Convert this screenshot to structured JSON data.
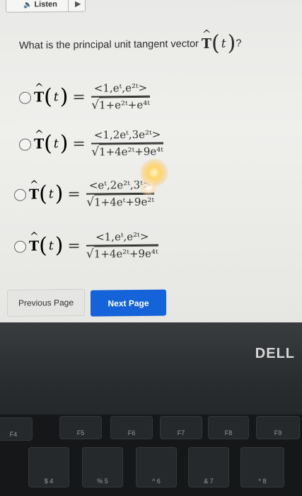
{
  "toolbar": {
    "listen_label": "Listen"
  },
  "question": {
    "text": "What is the principal unit tangent vector",
    "symbol": "T",
    "arg": "t",
    "end": "?"
  },
  "options": [
    {
      "numerator": "<1,eᵗ,e²ᵗ>",
      "radicand": "1+e²ᵗ+e⁴ᵗ"
    },
    {
      "numerator": "<1,2eᵗ,3e²ᵗ>",
      "radicand": "1+4e²ᵗ+9e⁴ᵗ"
    },
    {
      "numerator": "<eᵗ,2e²ᵗ,3ᵗ>",
      "radicand": "1+4eᵗ+9e²ᵗ"
    },
    {
      "numerator": "<1,eᵗ,e²ᵗ>",
      "radicand": "1+4e²ᵗ+9e⁴ᵗ"
    }
  ],
  "nav": {
    "previous_label": "Previous Page",
    "next_label": "Next Page"
  },
  "bezel": {
    "brand": "DELL"
  },
  "keys": [
    "F4",
    "F5",
    "F6",
    "F7",
    "F8",
    "F9",
    "$",
    "%",
    "^",
    "&",
    "*",
    "4",
    "5",
    "6",
    "7",
    "8"
  ],
  "colors": {
    "primary": "#1463d8"
  }
}
